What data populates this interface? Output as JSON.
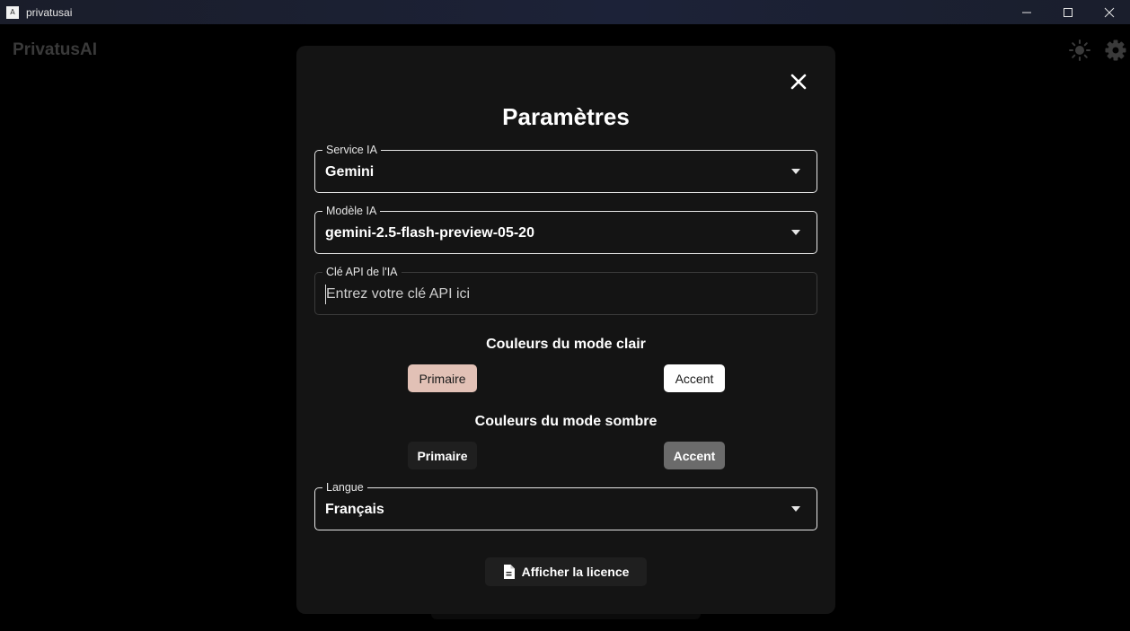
{
  "window": {
    "title": "privatusai",
    "icon_glyph": "A"
  },
  "app": {
    "brand": "PrivatusAI"
  },
  "dialog": {
    "title": "Paramètres",
    "service": {
      "label": "Service IA",
      "value": "Gemini"
    },
    "model": {
      "label": "Modèle IA",
      "value": "gemini-2.5-flash-preview-05-20"
    },
    "api_key": {
      "label": "Clé API de l'IA",
      "placeholder": "Entrez votre clé API ici",
      "value": ""
    },
    "light_colors": {
      "title": "Couleurs du mode clair",
      "primary_label": "Primaire",
      "accent_label": "Accent",
      "primary_color": "#e2c1b6",
      "accent_color": "#ffffff"
    },
    "dark_colors": {
      "title": "Couleurs du mode sombre",
      "primary_label": "Primaire",
      "accent_label": "Accent",
      "primary_color": "#1f1f1f",
      "accent_color": "#6b6b6b"
    },
    "language": {
      "label": "Langue",
      "value": "Français"
    },
    "license_button": "Afficher la licence"
  },
  "icons": [
    "close-icon",
    "sun-icon",
    "gear-icon",
    "document-icon",
    "chevron-down-icon",
    "minimize-icon",
    "maximize-icon",
    "window-close-icon"
  ]
}
